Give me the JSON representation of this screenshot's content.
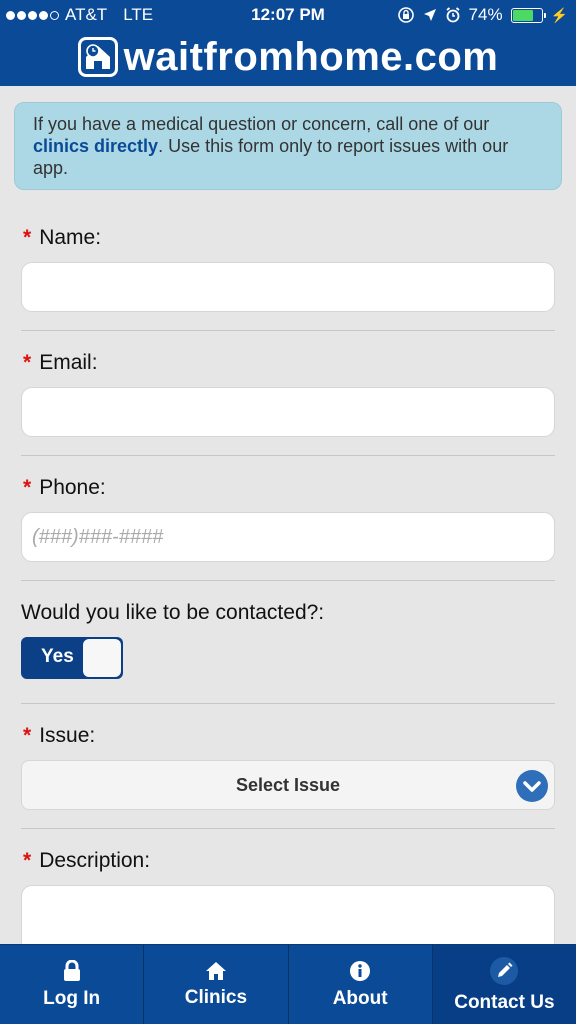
{
  "status_bar": {
    "carrier": "AT&T",
    "network": "LTE",
    "time": "12:07 PM",
    "battery_percent": "74%",
    "battery_level": 0.74
  },
  "header": {
    "brand": "waitfromhome.com"
  },
  "notice": {
    "text_before": "If you have a medical question or concern, call one of our ",
    "link": "clinics directly",
    "text_after": ". Use this form only to report issues with our app."
  },
  "form": {
    "required_marker": "*",
    "name_label": "Name:",
    "email_label": "Email:",
    "phone_label": "Phone:",
    "phone_placeholder": "(###)###-####",
    "contact_label": "Would you like to be contacted?:",
    "contact_toggle": "Yes",
    "issue_label": "Issue:",
    "issue_select": "Select Issue",
    "description_label": "Description:"
  },
  "tabs": [
    {
      "label": "Log In",
      "icon": "lock-icon"
    },
    {
      "label": "Clinics",
      "icon": "home-icon"
    },
    {
      "label": "About",
      "icon": "info-icon"
    },
    {
      "label": "Contact Us",
      "icon": "pencil-icon"
    }
  ],
  "colors": {
    "brand_blue": "#0b4a97",
    "notice_bg": "#acd8e6",
    "required_red": "#dd1111",
    "battery_green": "#4cd964"
  }
}
